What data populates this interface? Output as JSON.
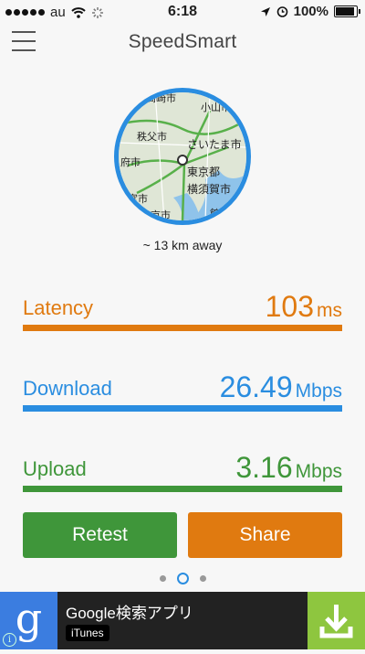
{
  "status_bar": {
    "carrier": "au",
    "time": "6:18",
    "battery": "100%",
    "battery_level": 1.0
  },
  "nav": {
    "title": "SpeedSmart"
  },
  "map": {
    "distance": "~ 13 km away",
    "places": [
      "高崎市",
      "小山市",
      "秩父市",
      "さいたま市",
      "府市",
      "東京都",
      "宮市",
      "横須賀市",
      "京市",
      "館"
    ]
  },
  "metrics": [
    {
      "label": "Latency",
      "value": "103",
      "unit": "ms",
      "color": "#e07a10"
    },
    {
      "label": "Download",
      "value": "26.49",
      "unit": "Mbps",
      "color": "#2a8de0"
    },
    {
      "label": "Upload",
      "value": "3.16",
      "unit": "Mbps",
      "color": "#3f963a"
    }
  ],
  "buttons": {
    "retest": "Retest",
    "share": "Share",
    "retest_color": "#3f963a",
    "share_color": "#e07a10"
  },
  "pager": {
    "count": 3,
    "active": 1
  },
  "ad": {
    "title": "Google検索アプリ",
    "badge": "iTunes",
    "logo_letter": "g",
    "info": "i"
  }
}
